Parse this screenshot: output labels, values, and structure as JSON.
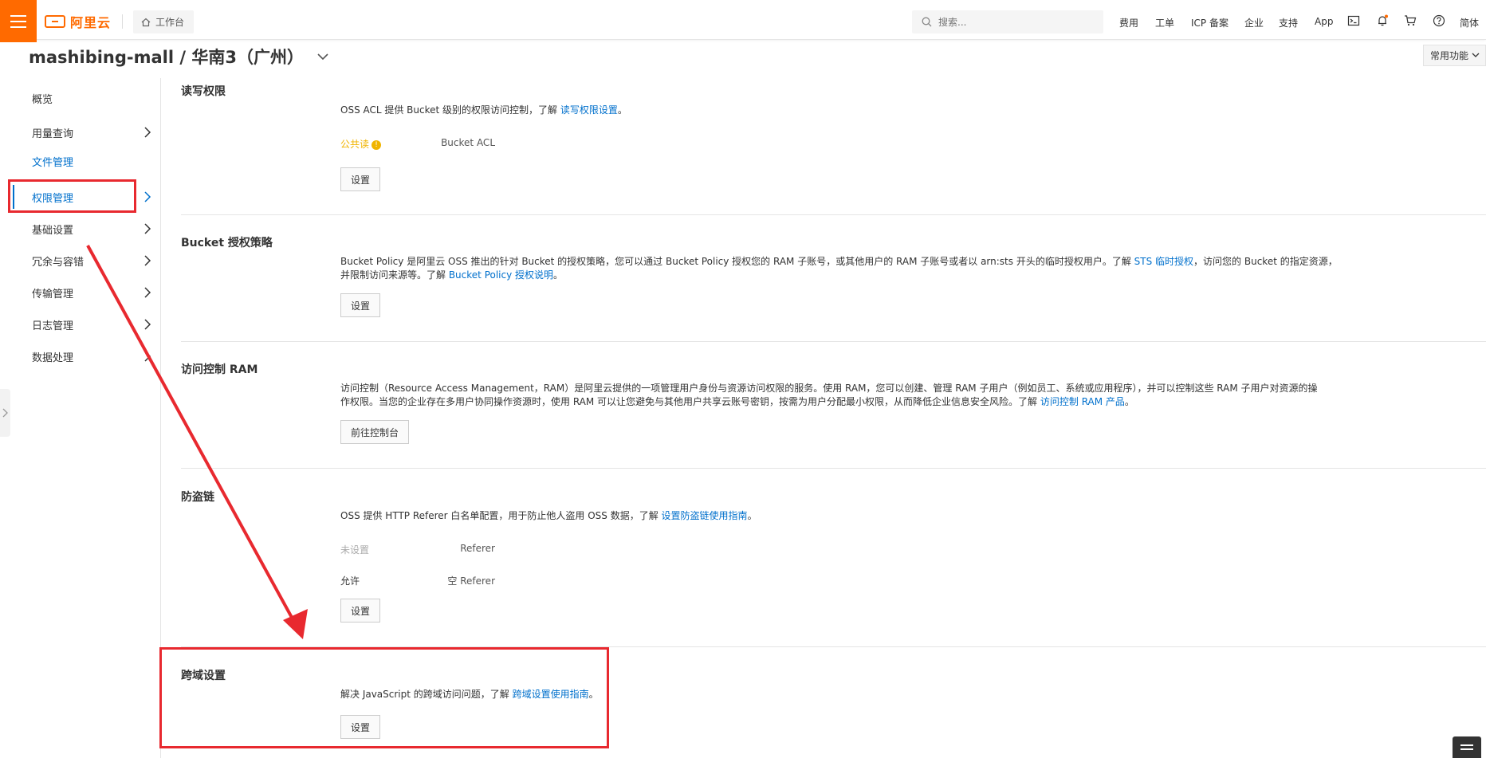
{
  "topbar": {
    "brand": "阿里云",
    "workbench": "工作台",
    "search_placeholder": "搜索...",
    "nav": [
      "费用",
      "工单",
      "ICP 备案",
      "企业",
      "支持",
      "App"
    ],
    "lang": "简体"
  },
  "header": {
    "title": "mashibing-mall / 华南3（广州）",
    "common_functions": "常用功能"
  },
  "sidebar": {
    "items": [
      {
        "label": "概览"
      },
      {
        "label": "用量查询"
      },
      {
        "label": "文件管理"
      },
      {
        "label": "权限管理"
      },
      {
        "label": "基础设置"
      },
      {
        "label": "冗余与容错"
      },
      {
        "label": "传输管理"
      },
      {
        "label": "日志管理"
      },
      {
        "label": "数据处理"
      }
    ]
  },
  "sections": {
    "acl": {
      "title": "读写权限",
      "desc_prefix": "OSS ACL 提供 Bucket 级别的权限访问控制，了解 ",
      "desc_link": "读写权限设置",
      "desc_suffix": "。",
      "label": "Bucket ACL",
      "value": "公共读",
      "button": "设置"
    },
    "policy": {
      "title": "Bucket 授权策略",
      "line1_prefix": "Bucket Policy 是阿里云 OSS 推出的针对 Bucket 的授权策略，您可以通过 Bucket Policy 授权您的 RAM 子账号，或其他用户的 RAM 子账号或者以 arn:sts 开头的临时授权用户。了解 ",
      "line1_link": "STS 临时授权",
      "line1_suffix": "，访问您的 Bucket 的指定资源，",
      "line2_prefix": "并限制访问来源等。了解 ",
      "line2_link": "Bucket Policy 授权说明",
      "line2_suffix": "。",
      "button": "设置"
    },
    "ram": {
      "title": "访问控制 RAM",
      "line1": "访问控制（Resource Access Management，RAM）是阿里云提供的一项管理用户身份与资源访问权限的服务。使用 RAM，您可以创建、管理 RAM 子用户（例如员工、系统或应用程序），并可以控制这些 RAM 子用户对资源的操",
      "line2_prefix": "作权限。当您的企业存在多用户协同操作资源时，使用 RAM 可以让您避免与其他用户共享云账号密钥，按需为用户分配最小权限，从而降低企业信息安全风险。了解 ",
      "line2_link": "访问控制 RAM 产品",
      "line2_suffix": "。",
      "button": "前往控制台"
    },
    "referer": {
      "title": "防盗链",
      "desc_prefix": "OSS 提供 HTTP Referer 白名单配置，用于防止他人盗用 OSS 数据，了解 ",
      "desc_link": "设置防盗链使用指南",
      "desc_suffix": "。",
      "label1": "Referer",
      "value1": "未设置",
      "label2": "空 Referer",
      "value2": "允许",
      "button": "设置"
    },
    "cors": {
      "title": "跨域设置",
      "desc_prefix": "解决 JavaScript 的跨域访问问题，了解 ",
      "desc_link": "跨域设置使用指南",
      "desc_suffix": "。",
      "button": "设置"
    }
  },
  "colors": {
    "brand": "#ff6a00",
    "link": "#0070cc",
    "annotation": "#e8292f",
    "acl_value": "#f0b400"
  }
}
